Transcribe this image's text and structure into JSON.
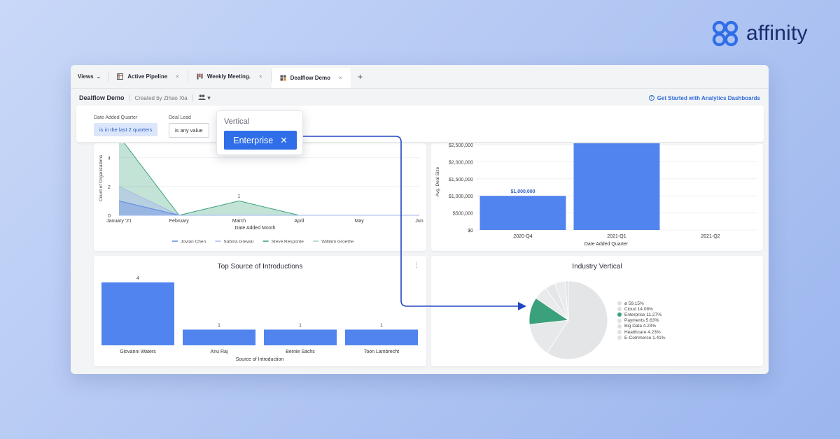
{
  "brand": {
    "name": "affinity",
    "color": "#2f6ee8"
  },
  "tabbar": {
    "views_label": "Views",
    "tabs": [
      {
        "label": "Active Pipeline",
        "close": "×",
        "icon": "table-icon"
      },
      {
        "label": "Weekly Meeting.",
        "close": "×",
        "icon": "board-icon"
      },
      {
        "label": "Dealflow Demo",
        "close": "×",
        "icon": "dashboard-icon",
        "active": true
      }
    ],
    "add_label": "+"
  },
  "subbar": {
    "title": "Dealflow Demo",
    "created_by": "Created by Zihao Xia",
    "share_caret": "▾",
    "help_link": "Get Started with Analytics Dashboards"
  },
  "filters": {
    "date_quarter": {
      "label": "Date Added Quarter",
      "value": "is in the last 2 quarters"
    },
    "deal_lead": {
      "label": "Deal Lead",
      "value": "is any value"
    }
  },
  "popover": {
    "label": "Vertical",
    "chip": "Enterprise",
    "close": "✕"
  },
  "colors": {
    "accent": "#2f6ee8",
    "bar": "#5184ee",
    "teal": "#3aa17c",
    "pie_grey": "#e3e5e7"
  },
  "chart_data": [
    {
      "type": "area",
      "ylabel": "Count of Organizations",
      "xlabel": "Date Added Month",
      "categories": [
        "January '21",
        "February",
        "March",
        "April",
        "May",
        "Jun"
      ],
      "y_ticks": [
        0,
        2,
        4
      ],
      "ylim": [
        0,
        5
      ],
      "series": [
        {
          "name": "Jovian Chen",
          "color": "#5f87e6",
          "values": [
            1,
            0,
            0,
            0,
            0,
            0
          ]
        },
        {
          "name": "Sabina Grewal",
          "color": "#a9b7e8",
          "values": [
            2,
            0,
            0,
            0,
            0,
            0
          ]
        },
        {
          "name": "Steve Responte",
          "color": "#3aa17c",
          "values": [
            5.5,
            0,
            1,
            0,
            0,
            0
          ]
        },
        {
          "name": "William Groethe",
          "color": "#9fd3b9",
          "values": [
            0,
            0,
            0,
            0,
            0,
            0
          ]
        }
      ],
      "annotations": [
        {
          "x": "March",
          "text": "1"
        }
      ]
    },
    {
      "type": "bar",
      "ylabel": "Avg. Deal Size",
      "xlabel": "Date Added Quarter",
      "categories": [
        "2020-Q4",
        "2021-Q1",
        "2021-Q2"
      ],
      "values": [
        1000000,
        2600000,
        0
      ],
      "data_labels": [
        "$1,000,000",
        "",
        ""
      ],
      "y_ticks": [
        "$0",
        "$500,000",
        "$1,000,000",
        "$1,500,000",
        "$2,000,000",
        "$2,500,000"
      ],
      "ylim": [
        0,
        2500000
      ]
    },
    {
      "type": "bar",
      "title": "Top Source of Introductions",
      "xlabel": "Source of Introduction",
      "categories": [
        "Giovanni Waters",
        "Anu Raj",
        "Bernie Sachs",
        "Toon Lambrecht"
      ],
      "values": [
        4,
        1,
        1,
        1
      ],
      "data_labels": [
        "4",
        "1",
        "1",
        "1"
      ],
      "ylim": [
        0,
        4
      ]
    },
    {
      "type": "pie",
      "title": "Industry Vertical",
      "slices": [
        {
          "label": "ø 59.15%",
          "value": 59.15,
          "highlight": false
        },
        {
          "label": "Cloud 14.08%",
          "value": 14.08,
          "highlight": false
        },
        {
          "label": "Enterprise 11.27%",
          "value": 11.27,
          "highlight": true
        },
        {
          "label": "Payments 5.63%",
          "value": 5.63,
          "highlight": false
        },
        {
          "label": "Big Data 4.23%",
          "value": 4.23,
          "highlight": false
        },
        {
          "label": "Healthcare 4.23%",
          "value": 4.23,
          "highlight": false
        },
        {
          "label": "E-Commerce 1.41%",
          "value": 1.41,
          "highlight": false
        }
      ]
    }
  ],
  "card_menu_icon": "⋮"
}
